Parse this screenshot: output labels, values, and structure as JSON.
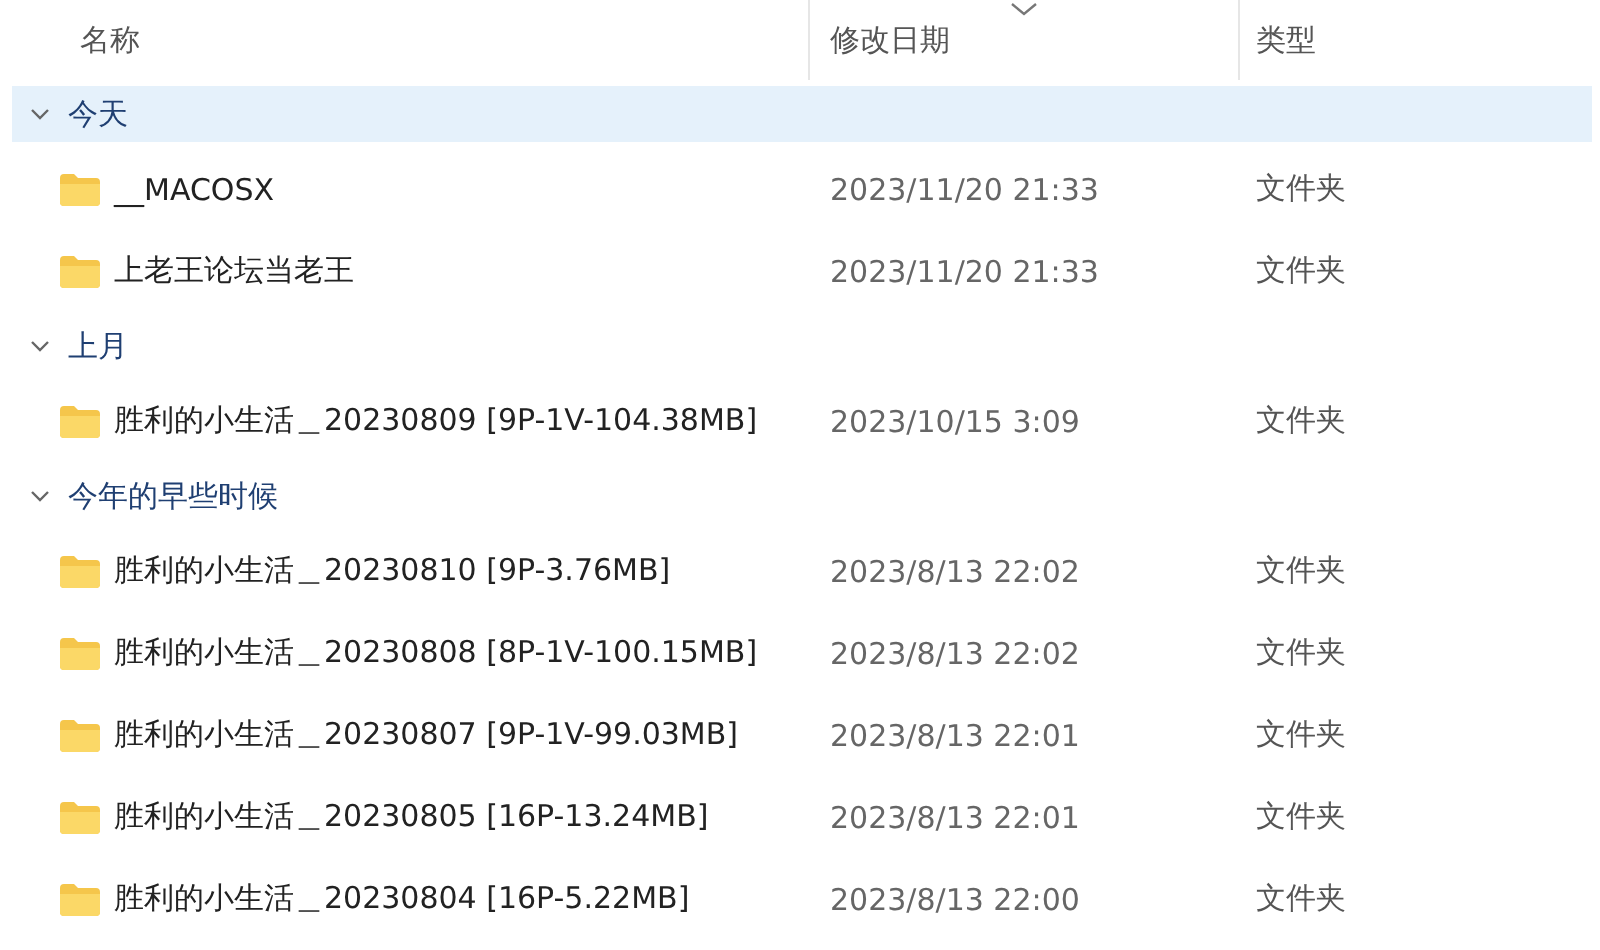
{
  "columns": [
    {
      "label": "名称",
      "sorted": false
    },
    {
      "label": "修改日期",
      "sorted": true
    },
    {
      "label": "类型",
      "sorted": false
    }
  ],
  "groups": [
    {
      "label": "今天",
      "selected": true,
      "expanded": true,
      "items": [
        {
          "name": "__MACOSX",
          "date": "2023/11/20 21:33",
          "type": "文件夹"
        },
        {
          "name": "上老王论坛当老王",
          "date": "2023/11/20 21:33",
          "type": "文件夹"
        }
      ]
    },
    {
      "label": "上月",
      "selected": false,
      "expanded": true,
      "items": [
        {
          "name": "胜利的小生活＿20230809 [9P-1V-104.38MB]",
          "date": "2023/10/15 3:09",
          "type": "文件夹"
        }
      ]
    },
    {
      "label": "今年的早些时候",
      "selected": false,
      "expanded": true,
      "items": [
        {
          "name": "胜利的小生活＿20230810 [9P-3.76MB]",
          "date": "2023/8/13 22:02",
          "type": "文件夹"
        },
        {
          "name": "胜利的小生活＿20230808 [8P-1V-100.15MB]",
          "date": "2023/8/13 22:02",
          "type": "文件夹"
        },
        {
          "name": "胜利的小生活＿20230807 [9P-1V-99.03MB]",
          "date": "2023/8/13 22:01",
          "type": "文件夹"
        },
        {
          "name": "胜利的小生活＿20230805 [16P-13.24MB]",
          "date": "2023/8/13 22:01",
          "type": "文件夹"
        },
        {
          "name": "胜利的小生活＿20230804 [16P-5.22MB]",
          "date": "2023/8/13 22:00",
          "type": "文件夹"
        }
      ]
    }
  ]
}
